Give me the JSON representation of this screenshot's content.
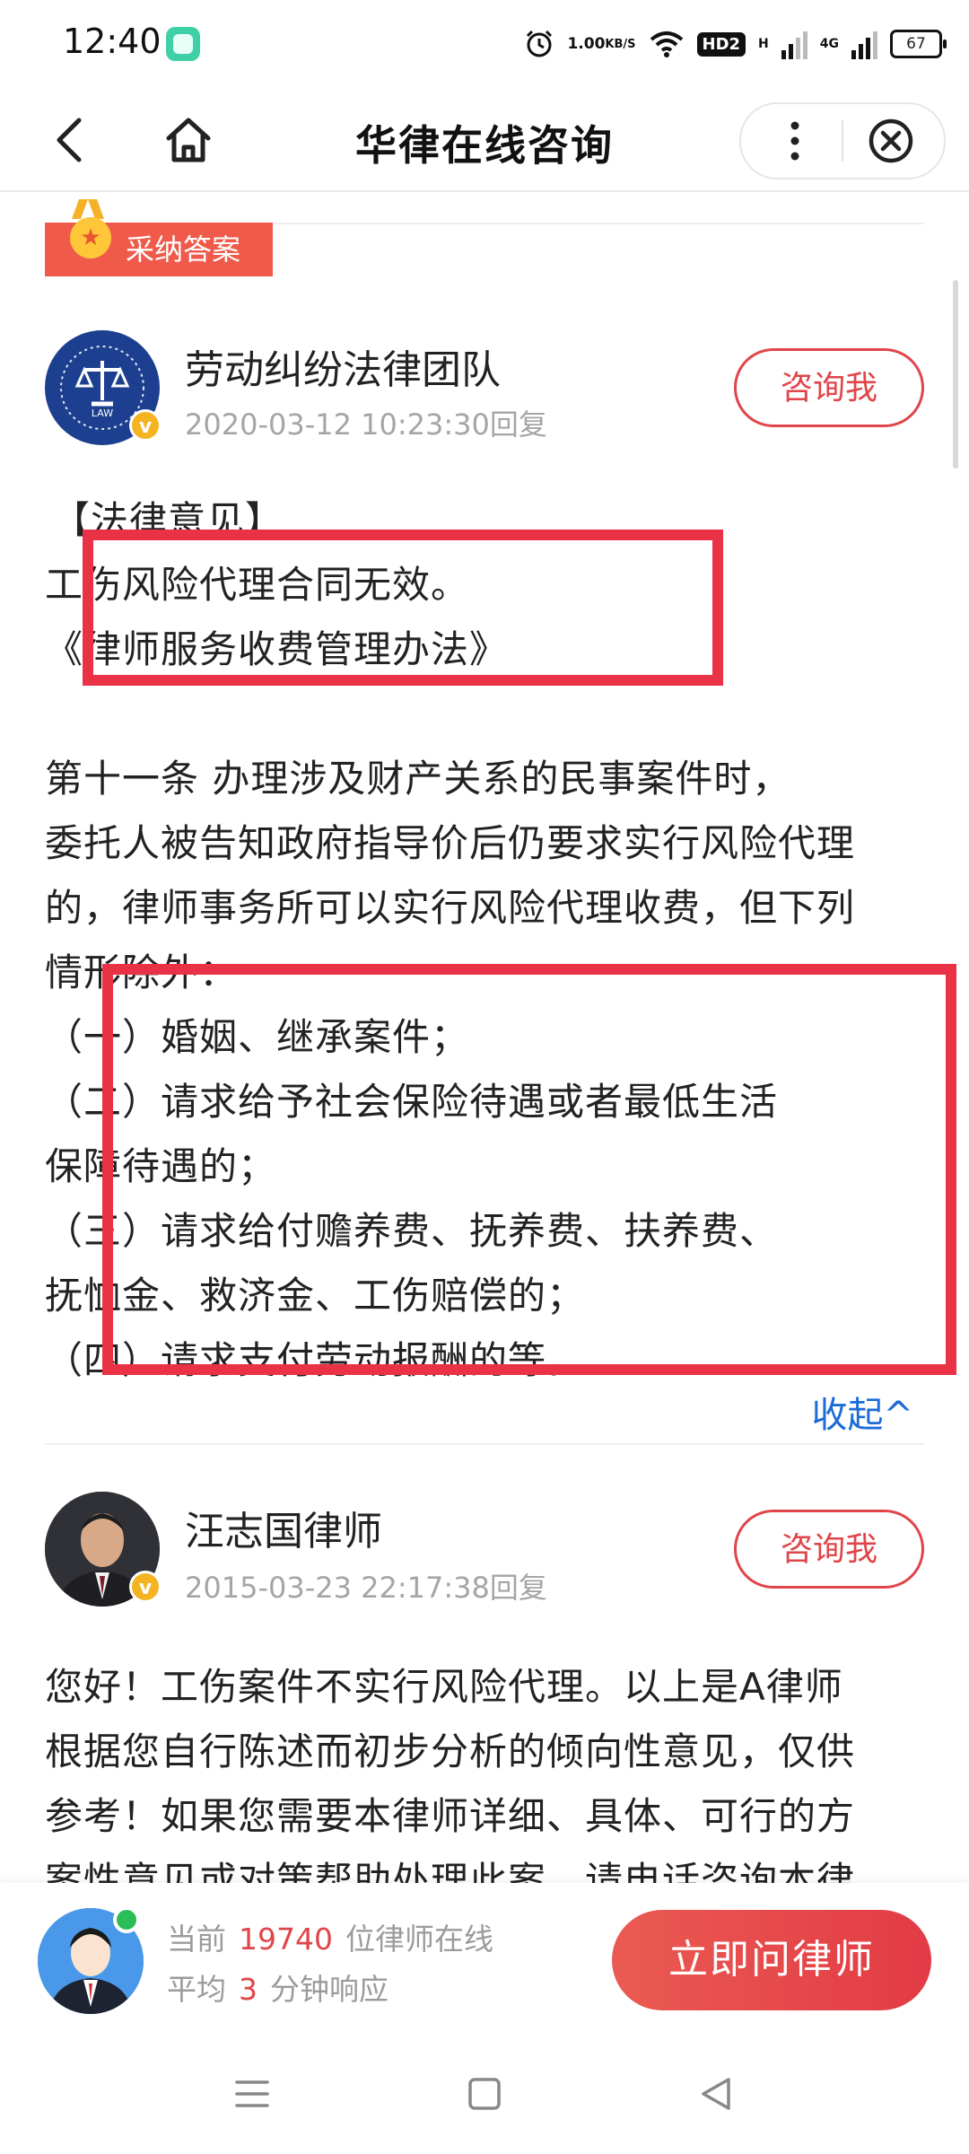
{
  "status_bar": {
    "time": "12:40",
    "speed_value": "1.00",
    "speed_unit": "KB/S",
    "hd_label": "HD2",
    "net_h": "H",
    "net_4g": "4G",
    "battery": "67"
  },
  "nav": {
    "title": "华律在线咨询"
  },
  "adopted_label": "采纳答案",
  "answers": [
    {
      "name": "劳动纠纷法律团队",
      "time": "2020-03-12 10:23:30回复",
      "consult_label": "咨询我",
      "avatar_text": "LAW",
      "lines": [
        "【法律意见】",
        "    工伤风险代理合同无效。",
        "   《律师服务收费管理办法》",
        "",
        "      第十一条 办理涉及财产关系的民事案件时，",
        "委托人被告知政府指导价后仍要求实行风险代理",
        "的，律师事务所可以实行风险代理收费，但下列",
        "情形除外：",
        "    （一）婚姻、继承案件；",
        "    （二）请求给予社会保险待遇或者最低生活",
        "保障待遇的；",
        "    （三）请求给付赡养费、抚养费、扶养费、",
        "抚恤金、救济金、工伤赔偿的；",
        "    （四）请求支付劳动报酬的等。"
      ],
      "collapse_label": "收起^"
    },
    {
      "name": "汪志国律师",
      "time": "2015-03-23 22:17:38回复",
      "consult_label": "咨询我",
      "lines": [
        "您好！工伤案件不实行风险代理。以上是A律师",
        "根据您自行陈述而初步分析的倾向性意见，仅供",
        "参考！如果您需要本律师详细、具体、可行的方",
        "案性意见或对策帮助处理此案，请电话咨询本律"
      ]
    }
  ],
  "bottom": {
    "line1_prefix": "当前",
    "online_count": "19740",
    "line1_suffix": "位律师在线",
    "line2_prefix": "平均",
    "response_minutes": "3",
    "line2_suffix": "分钟响应",
    "ask_button": "立即问律师"
  },
  "colors": {
    "accent_red": "#e0454a",
    "highlight_box": "#e93246",
    "link_blue": "#1a6bd8",
    "badge_orange": "#f05a4a"
  },
  "icons": [
    "back-icon",
    "home-icon",
    "more-icon",
    "close-icon",
    "medal-icon",
    "verified-icon",
    "menu-icon",
    "square-icon",
    "triangle-back-icon"
  ]
}
